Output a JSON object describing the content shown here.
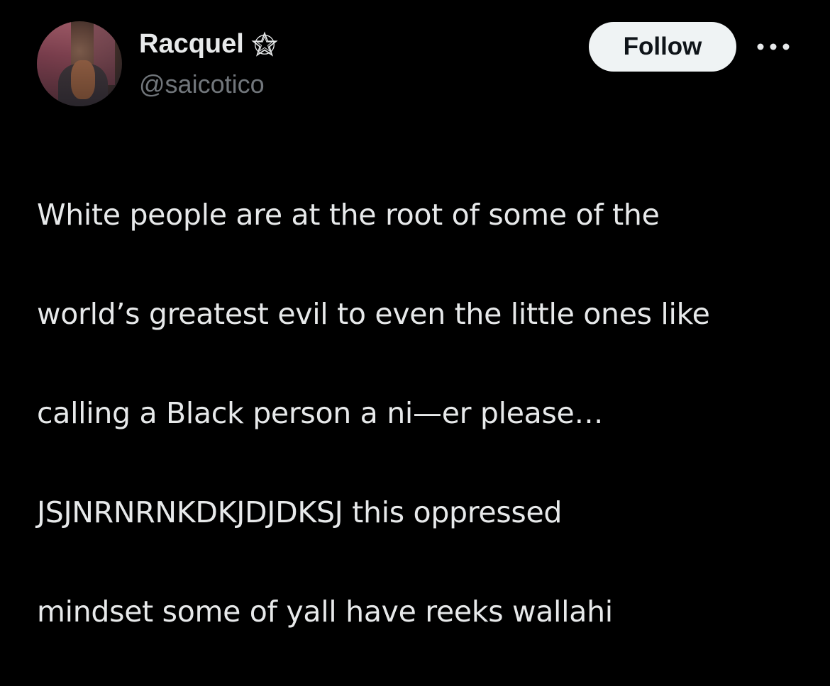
{
  "author": {
    "display_name": "Racquel",
    "name_icon": "pentagram-star-icon",
    "handle": "@saicotico"
  },
  "actions": {
    "follow_label": "Follow",
    "more_icon": "more-options-icon"
  },
  "tweet": {
    "lines": [
      "White people are at the root of some of the",
      "world’s greatest evil to even the little ones like",
      "calling a Black person a ni—er please…",
      "JSJNRNRNKDKJDJDKSJ this oppressed",
      "mindset some of yall have reeks wallahi"
    ]
  },
  "colors": {
    "background": "#000000",
    "text_primary": "#e7e9ea",
    "text_secondary": "#71767b",
    "button_bg": "#eff3f4",
    "button_text": "#0f1419"
  }
}
